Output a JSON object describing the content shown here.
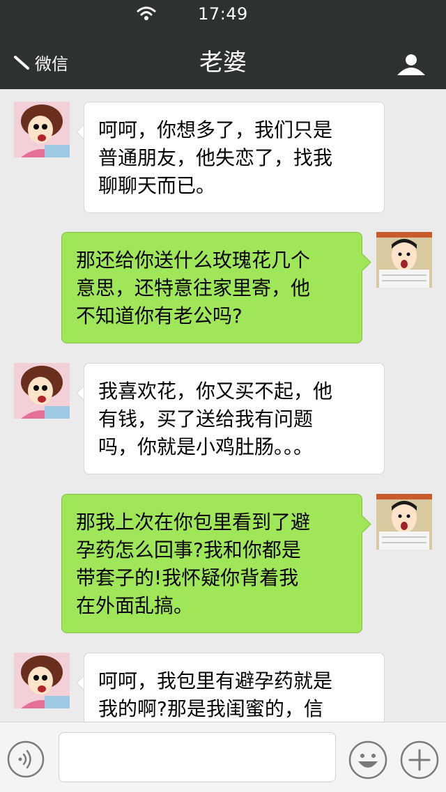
{
  "status": {
    "time": "17:49"
  },
  "header": {
    "back_label": "微信",
    "title": "老婆"
  },
  "messages": [
    {
      "side": "left",
      "avatar": "wife-avatar",
      "lines": [
        "呵呵，你想多了，我们只是",
        "普通朋友，他失恋了，找我",
        "聊聊天而已。"
      ]
    },
    {
      "side": "right",
      "avatar": "husband-avatar",
      "lines": [
        "那还给你送什么玫瑰花几个",
        "意思，还特意往家里寄，他",
        "不知道你有老公吗?"
      ]
    },
    {
      "side": "left",
      "avatar": "wife-avatar",
      "lines": [
        "我喜欢花，你又买不起，他",
        "有钱，买了送给我有问题",
        "吗，你就是小鸡肚肠。。。"
      ]
    },
    {
      "side": "right",
      "avatar": "husband-avatar",
      "lines": [
        "那我上次在你包里看到了避",
        "孕药怎么回事?我和你都是",
        "带套子的!我怀疑你背着我",
        "在外面乱搞。"
      ]
    },
    {
      "side": "left",
      "avatar": "wife-avatar",
      "lines": [
        "呵呵，我包里有避孕药就是",
        "我的啊?那是我闺蜜的，信"
      ]
    }
  ],
  "input": {
    "value": "",
    "placeholder": ""
  },
  "icons": {
    "wifi": "wifi-icon",
    "back": "back-arrow-icon",
    "profile": "person-icon",
    "voice": "voice-icon",
    "emoji": "emoji-icon",
    "plus": "plus-icon"
  },
  "colors": {
    "header": "#2e3132",
    "chat_bg": "#ebebeb",
    "sent_bubble": "#9fe658",
    "received_bubble": "#ffffff"
  }
}
